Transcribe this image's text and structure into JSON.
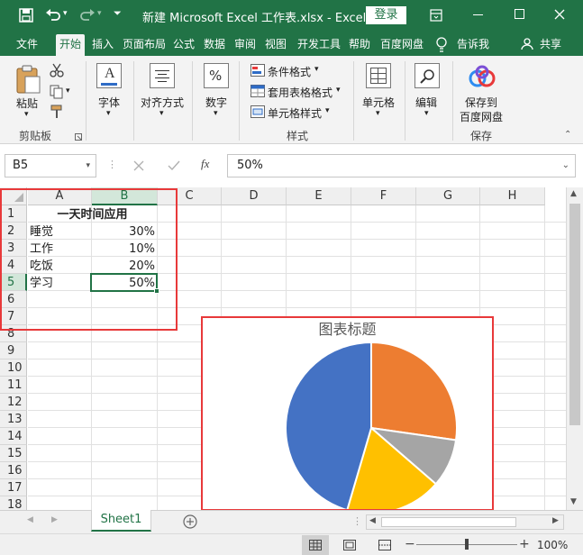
{
  "window": {
    "title": "新建 Microsoft Excel 工作表.xlsx  -  Excel",
    "login_label": "登录"
  },
  "ribbon_tabs": [
    "文件",
    "开始",
    "插入",
    "页面布局",
    "公式",
    "数据",
    "审阅",
    "视图",
    "开发工具",
    "帮助",
    "百度网盘"
  ],
  "tell_me": "告诉我",
  "share": "共享",
  "ribbon": {
    "paste": "粘贴",
    "clipboard_group": "剪贴板",
    "font": "字体",
    "alignment": "对齐方式",
    "number": "数字",
    "conditional_format": "条件格式",
    "table_format": "套用表格格式",
    "cell_styles": "单元格样式",
    "styles_group": "样式",
    "cells": "单元格",
    "editing": "编辑",
    "save_to": "保存到",
    "baidu_pan": "百度网盘",
    "save_group": "保存"
  },
  "formula_bar": {
    "name_box": "B5",
    "fx": "fx",
    "value": "50%"
  },
  "columns": [
    "A",
    "B",
    "C",
    "D",
    "E",
    "F",
    "G",
    "H"
  ],
  "rows": [
    "1",
    "2",
    "3",
    "4",
    "5",
    "6",
    "7",
    "8",
    "9",
    "10",
    "11",
    "12",
    "13",
    "14",
    "15",
    "16",
    "17",
    "18"
  ],
  "sheet": {
    "header": "一天时间应用",
    "rows": [
      {
        "label": "睡觉",
        "value": "30%"
      },
      {
        "label": "工作",
        "value": "10%"
      },
      {
        "label": "吃饭",
        "value": "20%"
      },
      {
        "label": "学习",
        "value": "50%"
      }
    ]
  },
  "chart_data": {
    "type": "pie",
    "title": "图表标题",
    "categories": [
      "睡觉",
      "工作",
      "吃饭",
      "学习"
    ],
    "values": [
      30,
      10,
      20,
      50
    ],
    "colors": [
      "#ed7d31",
      "#a5a5a5",
      "#ffc000",
      "#4472c4"
    ]
  },
  "sheet_tab": "Sheet1",
  "status": {
    "zoom": "100%"
  },
  "colors": {
    "accent": "#217346",
    "highlight": "#e8393a"
  }
}
